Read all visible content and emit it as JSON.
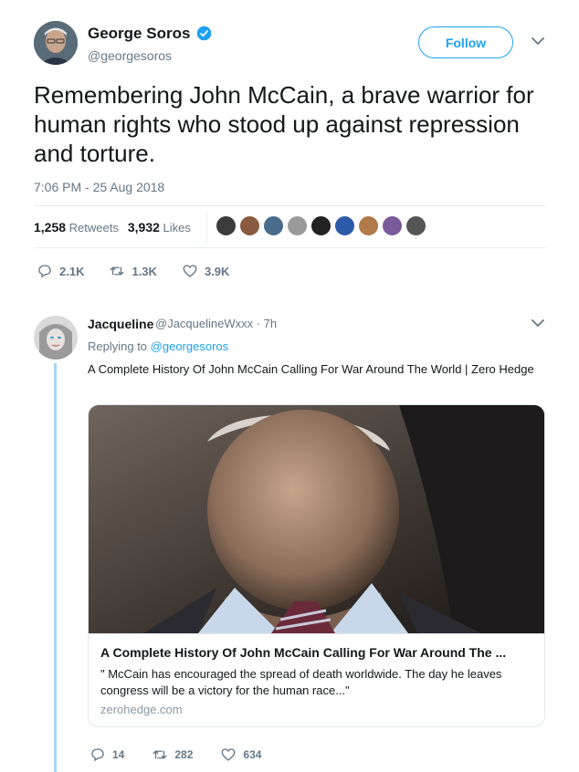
{
  "tweet": {
    "author_name": "George Soros",
    "author_handle": "@georgesoros",
    "follow_label": "Follow",
    "text": "Remembering John McCain, a brave warrior for human rights who stood up against repression and torture.",
    "timestamp": "7:06 PM - 25 Aug 2018",
    "retweets_count": "1,258",
    "retweets_label": "Retweets",
    "likes_count": "3,932",
    "likes_label": "Likes",
    "actions": {
      "replies": "2.1K",
      "retweets": "1.3K",
      "likes": "3.9K"
    }
  },
  "reply": {
    "author_name": "Jacqueline",
    "author_handle": "@JacquelineWxxx · 7h",
    "replying_prefix": "Replying to",
    "replying_to": "@georgesoros",
    "text": "A Complete History Of John McCain Calling For War Around The World | Zero Hedge",
    "card": {
      "title": "A Complete History Of John McCain Calling For War Around The ...",
      "description": "\" McCain has encouraged the spread of death worldwide. The day he leaves congress will be a victory for the human race...\"",
      "domain": "zerohedge.com"
    },
    "actions": {
      "replies": "14",
      "retweets": "282",
      "likes": "634"
    }
  },
  "colors": {
    "accent": "#1da1f2",
    "secondary_text": "#657786",
    "thread_line": "#a8d8f5"
  }
}
